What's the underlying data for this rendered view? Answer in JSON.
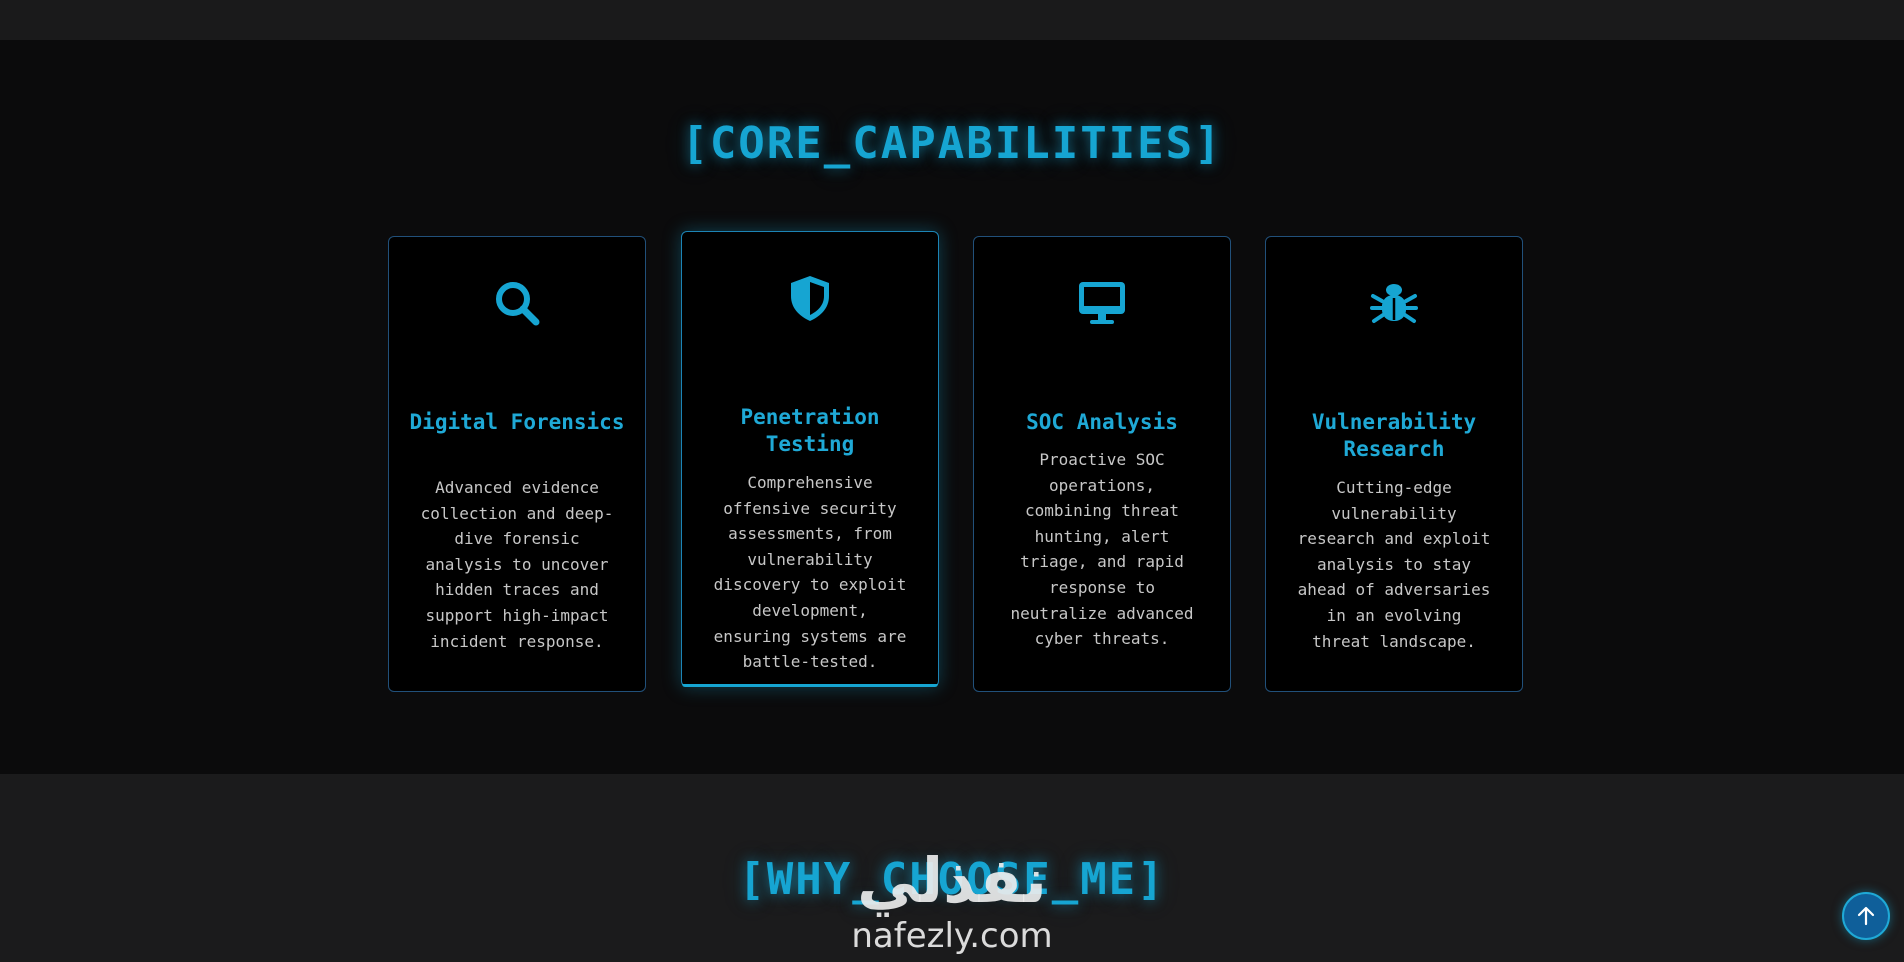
{
  "capabilities": {
    "title": "[CORE_CAPABILITIES]",
    "cards": [
      {
        "icon": "search-icon",
        "title": "Digital Forensics",
        "description": "Advanced evidence collection and deep-dive forensic analysis to uncover hidden traces and support high-impact incident response."
      },
      {
        "icon": "shield-icon",
        "title": "Penetration Testing",
        "description": "Comprehensive offensive security assessments, from vulnerability discovery to exploit development, ensuring systems are battle-tested."
      },
      {
        "icon": "desktop-icon",
        "title": "SOC Analysis",
        "description": "Proactive SOC operations, combining threat hunting, alert triage, and rapid response to neutralize advanced cyber threats."
      },
      {
        "icon": "bug-icon",
        "title": "Vulnerability Research",
        "description": "Cutting-edge vulnerability research and exploit analysis to stay ahead of adversaries in an evolving threat landscape."
      }
    ]
  },
  "why": {
    "title": "[WHY_CHOOSE_ME]"
  },
  "watermark": {
    "logo": "نفذلي",
    "url": "nafezly.com"
  },
  "scroll_top": {
    "icon": "arrow-up-icon"
  },
  "colors": {
    "accent": "#16a5d2",
    "card_border": "#21507a",
    "background": "#0b0b0c"
  }
}
